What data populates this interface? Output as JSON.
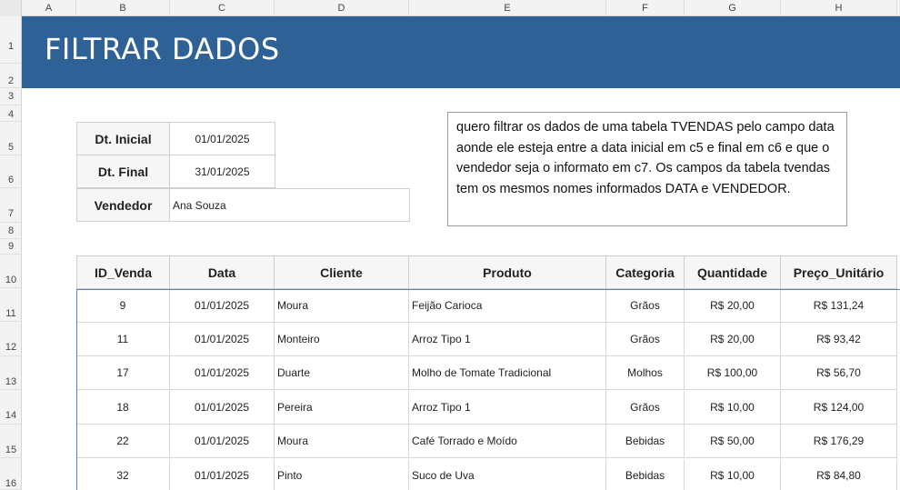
{
  "columns": [
    "A",
    "B",
    "C",
    "D",
    "E",
    "F",
    "G",
    "H"
  ],
  "rows": [
    "1",
    "2",
    "3",
    "4",
    "5",
    "6",
    "7",
    "8",
    "9",
    "10",
    "11",
    "12",
    "13",
    "14",
    "15",
    "16"
  ],
  "banner": {
    "title": "FILTRAR DADOS"
  },
  "filters": {
    "dt_inicial_label": "Dt. Inicial",
    "dt_inicial_value": "01/01/2025",
    "dt_final_label": "Dt. Final",
    "dt_final_value": "31/01/2025",
    "vendedor_label": "Vendedor",
    "vendedor_value": "Ana Souza"
  },
  "note": {
    "text": "quero filtrar os dados de uma tabela TVENDAS pelo campo data aonde ele esteja entre a data inicial em c5 e final em c6 e que o vendedor seja o informato em c7. Os campos da tabela tvendas tem os mesmos nomes informados DATA e VENDEDOR."
  },
  "table": {
    "headers": [
      "ID_Venda",
      "Data",
      "Cliente",
      "Produto",
      "Categoria",
      "Quantidade",
      "Preço_Unitário"
    ],
    "rows": [
      [
        "9",
        "01/01/2025",
        "Moura",
        "Feijão Carioca",
        "Grãos",
        "R$ 20,00",
        "R$ 131,24"
      ],
      [
        "11",
        "01/01/2025",
        "Monteiro",
        "Arroz Tipo 1",
        "Grãos",
        "R$ 20,00",
        "R$ 93,42"
      ],
      [
        "17",
        "01/01/2025",
        "Duarte",
        "Molho de Tomate Tradicional",
        "Molhos",
        "R$ 100,00",
        "R$ 56,70"
      ],
      [
        "18",
        "01/01/2025",
        "Pereira",
        "Arroz Tipo 1",
        "Grãos",
        "R$ 10,00",
        "R$ 124,00"
      ],
      [
        "22",
        "01/01/2025",
        "Moura",
        "Café Torrado e Moído",
        "Bebidas",
        "R$ 50,00",
        "R$ 176,29"
      ],
      [
        "32",
        "01/01/2025",
        "Pinto",
        "Suco de Uva",
        "Bebidas",
        "R$ 10,00",
        "R$ 84,80"
      ]
    ]
  },
  "colors": {
    "banner": "#2e6196",
    "selection": "#5b7fb6"
  }
}
